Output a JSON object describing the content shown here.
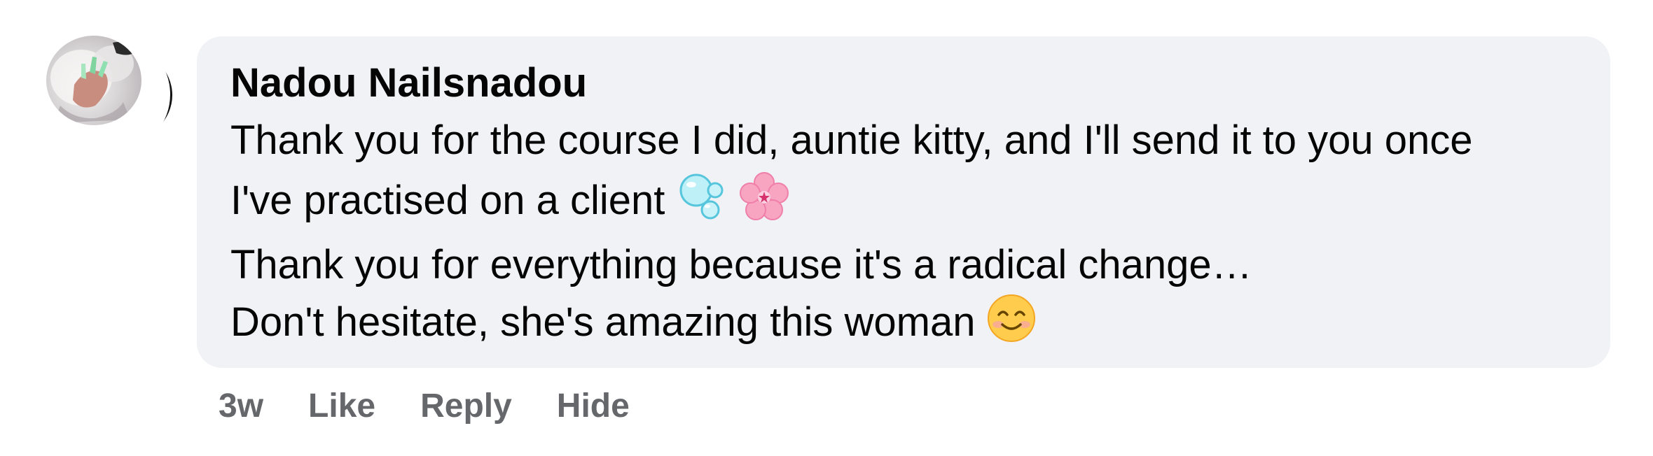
{
  "comment": {
    "author": "Nadou Nailsnadou",
    "lines": [
      "Thank you for the course I did, auntie kitty, and I'll send it to you once",
      "I've practised on a client",
      "Thank you for everything because it's a radical change…",
      "Don't hesitate, she's amazing this woman"
    ],
    "emoji_icons": [
      "bubbles-icon",
      "cherry-blossom-icon",
      "smiling-face-icon"
    ]
  },
  "actions": {
    "timestamp": "3w",
    "like_label": "Like",
    "reply_label": "Reply",
    "hide_label": "Hide"
  },
  "colors": {
    "bubble_bg": "#f0f2f5",
    "text": "#050505",
    "secondary_text": "#65676b"
  }
}
